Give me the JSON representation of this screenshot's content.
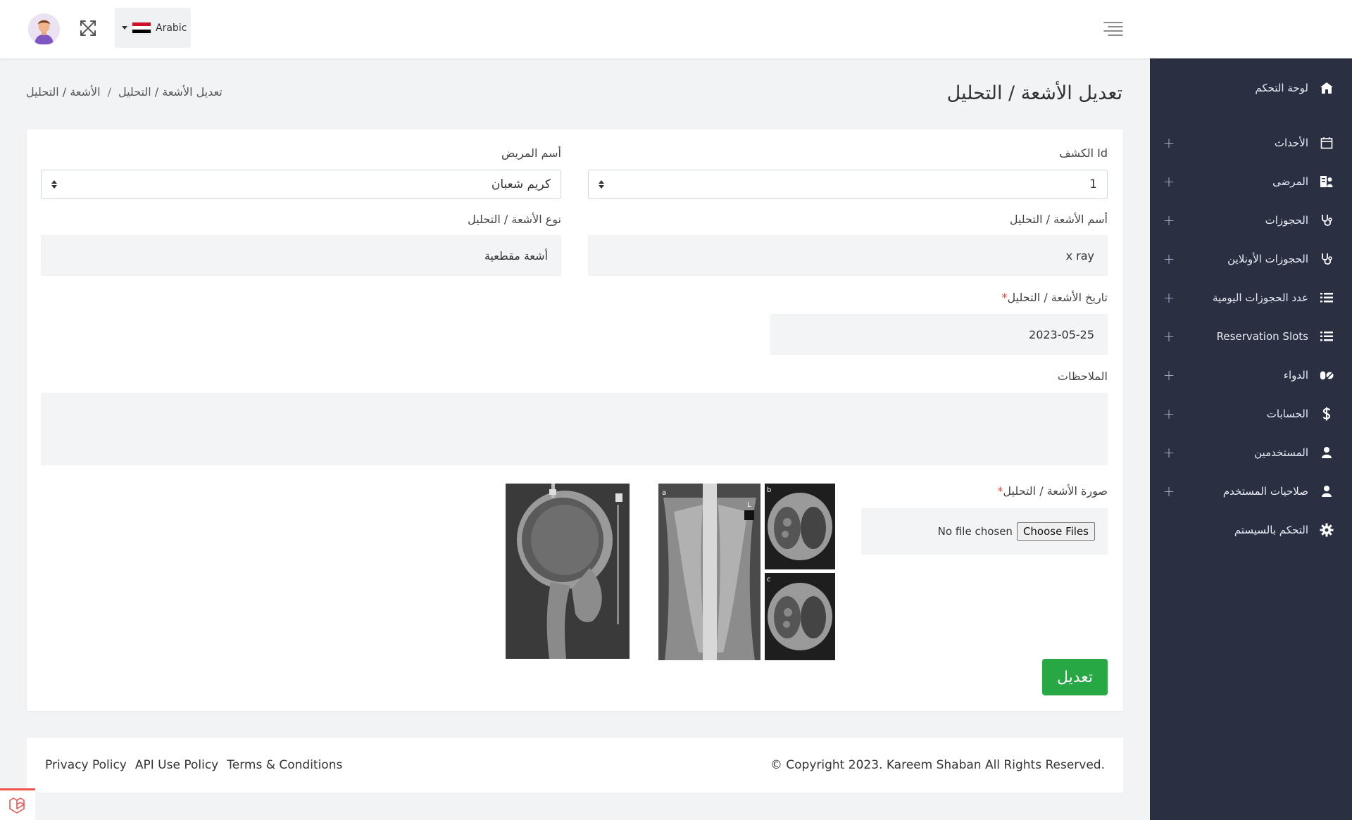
{
  "topbar": {
    "language_label": "Arabic",
    "avatar_icon": "user-avatar",
    "expand_icon": "fullscreen-icon",
    "menu_icon": "hamburger-icon"
  },
  "sidebar": {
    "items": [
      {
        "label": "لوحة التحكم",
        "icon": "home-icon",
        "expandable": false
      },
      {
        "label": "الأحداث",
        "icon": "calendar-icon",
        "expandable": true
      },
      {
        "label": "المرضى",
        "icon": "patient-icon",
        "expandable": true
      },
      {
        "label": "الحجوزات",
        "icon": "stethoscope-icon",
        "expandable": true
      },
      {
        "label": "الحجوزات الأونلاين",
        "icon": "stethoscope-icon",
        "expandable": true
      },
      {
        "label": "عدد الحجوزات اليومية",
        "icon": "list-icon",
        "expandable": true
      },
      {
        "label": "Reservation Slots",
        "icon": "list-icon",
        "expandable": true
      },
      {
        "label": "الدواء",
        "icon": "pills-icon",
        "expandable": true
      },
      {
        "label": "الحسابات",
        "icon": "dollar-icon",
        "expandable": true
      },
      {
        "label": "المستخدمين",
        "icon": "user-icon",
        "expandable": true
      },
      {
        "label": "صلاحيات المستخدم",
        "icon": "user-icon",
        "expandable": true
      },
      {
        "label": "التحكم بالسيستم",
        "icon": "gear-icon",
        "expandable": false
      }
    ],
    "expand_symbol": "+"
  },
  "header": {
    "title": "تعديل الأشعة / التحليل",
    "breadcrumb": [
      "الأشعة / التحليل",
      "/",
      "تعديل الأشعة / التحليل"
    ]
  },
  "form": {
    "exam_id_label": "Id الكشف",
    "exam_id_value": "1",
    "patient_name_label": "أسم المريض",
    "patient_name_value": "كريم شعبان",
    "scan_name_label": "أسم الأشعة / التحليل",
    "scan_name_value": "x ray",
    "scan_type_label": "نوع الأشعة / التحليل",
    "scan_type_value": "أشعة مقطعية",
    "scan_date_label": "تاريخ الأشعة / التحليل",
    "scan_date_value": "2023-05-25",
    "notes_label": "الملاحظات",
    "notes_value": "",
    "image_label": "صورة الأشعة / التحليل",
    "file_status": "No file chosen",
    "choose_files_label": "Choose Files",
    "required_mark": "*",
    "submit_label": "تعديل",
    "ct_panel_labels": [
      "a",
      "b",
      "c"
    ],
    "ct_marker": "L"
  },
  "footer": {
    "links": [
      "Privacy Policy",
      "API Use Policy",
      "Terms & Conditions"
    ],
    "copyright": "© Copyright 2023. Kareem Shaban All Rights Reserved."
  },
  "colors": {
    "sidebar_bg": "#2a3042",
    "submit_bg": "#28a745",
    "required": "#e74c3c"
  }
}
